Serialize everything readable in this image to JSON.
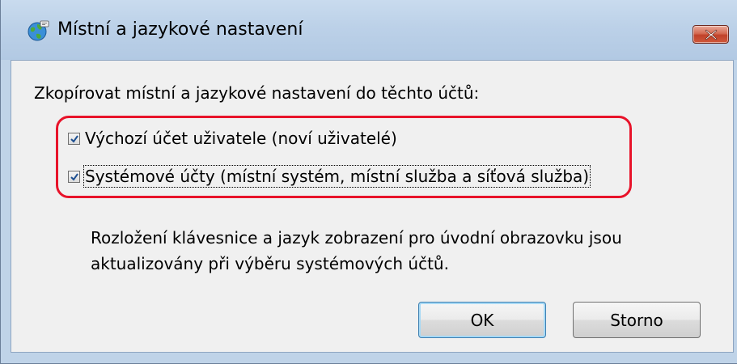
{
  "window": {
    "title": "Místní a jazykové nastavení",
    "title_icon": "globe-icon"
  },
  "dialog": {
    "instruction": "Zkopírovat místní a jazykové nastavení do těchto účtů:",
    "options": [
      {
        "label": "Výchozí účet uživatele (noví uživatelé)",
        "checked": true
      },
      {
        "label": "Systémové účty (místní systém, místní služba a síťová služba)",
        "checked": true
      }
    ],
    "note": "Rozložení klávesnice a jazyk zobrazení pro úvodní obrazovku jsou aktualizovány při výběru systémových účtů."
  },
  "buttons": {
    "ok": "OK",
    "cancel": "Storno"
  },
  "colors": {
    "highlight": "#e8132a",
    "checkmark": "#1d4f91",
    "close_button": "#c0412a"
  }
}
